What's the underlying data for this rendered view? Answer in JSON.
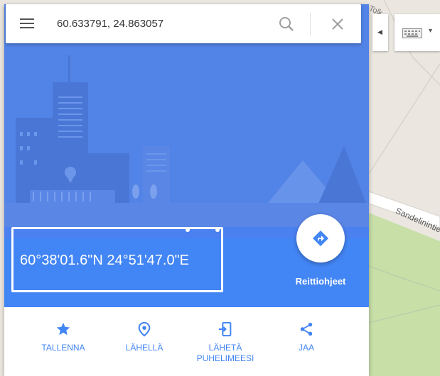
{
  "search": {
    "value": "60.633791, 24.863057"
  },
  "place": {
    "coordinates_dms": "60°38'01.6\"N 24°51'47.0\"E"
  },
  "directions": {
    "label": "Reittiohjeet"
  },
  "actions": [
    {
      "label": "TALLENNA",
      "icon": "star-icon"
    },
    {
      "label": "LÄHELLÄ",
      "icon": "nearby-pin-icon"
    },
    {
      "label": "LÄHETÄ PUHELIMEESI",
      "icon": "send-to-phone-icon"
    },
    {
      "label": "JAA",
      "icon": "share-icon"
    }
  ],
  "map": {
    "road_label": "Sandelinintie",
    "road_label_top": "Tolk"
  },
  "colors": {
    "accent": "#4285f4",
    "hero_background": "#5283e6",
    "map_background": "#ebe7e0",
    "park_green": "#c8dfa8"
  }
}
